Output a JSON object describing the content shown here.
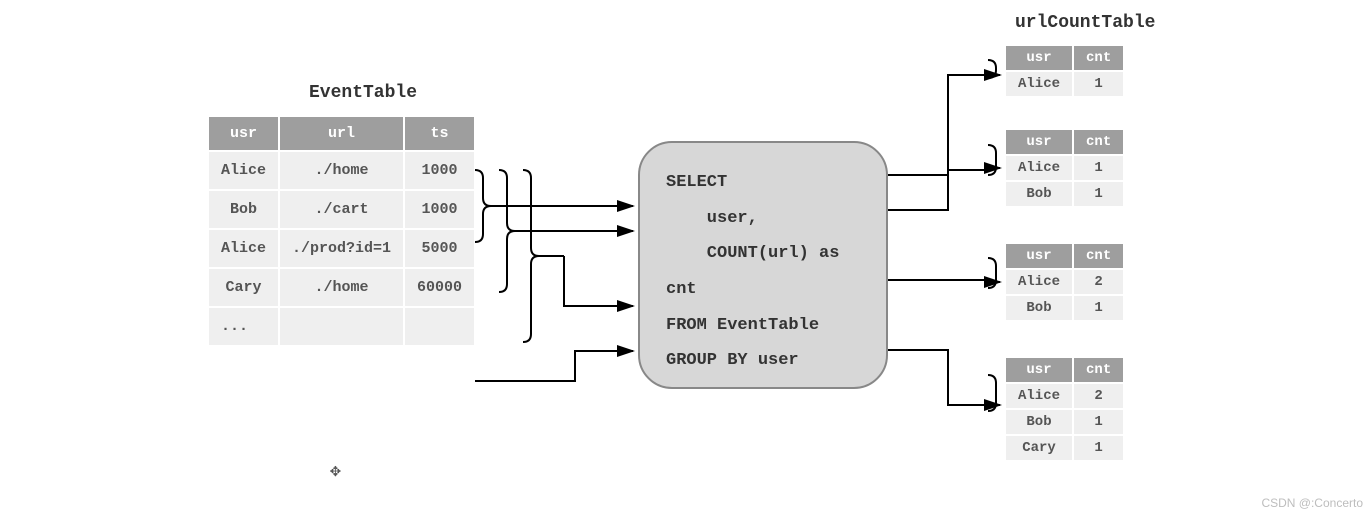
{
  "eventTable": {
    "title": "EventTable",
    "headers": [
      "usr",
      "url",
      "ts"
    ],
    "rows": [
      [
        "Alice",
        "./home",
        "1000"
      ],
      [
        "Bob",
        "./cart",
        "1000"
      ],
      [
        "Alice",
        "./prod?id=1",
        "5000"
      ],
      [
        "Cary",
        "./home",
        "60000"
      ],
      [
        "...",
        "",
        ""
      ]
    ]
  },
  "sql": "SELECT\n    user,\n    COUNT(url) as\ncnt\nFROM EventTable\nGROUP BY user",
  "urlCountTable": {
    "title": "urlCountTable",
    "headers": [
      "usr",
      "cnt"
    ],
    "snapshots": [
      [
        [
          "Alice",
          "1"
        ]
      ],
      [
        [
          "Alice",
          "1"
        ],
        [
          "Bob",
          "1"
        ]
      ],
      [
        [
          "Alice",
          "2"
        ],
        [
          "Bob",
          "1"
        ]
      ],
      [
        [
          "Alice",
          "2"
        ],
        [
          "Bob",
          "1"
        ],
        [
          "Cary",
          "1"
        ]
      ]
    ]
  },
  "watermark": "CSDN @:Concerto"
}
